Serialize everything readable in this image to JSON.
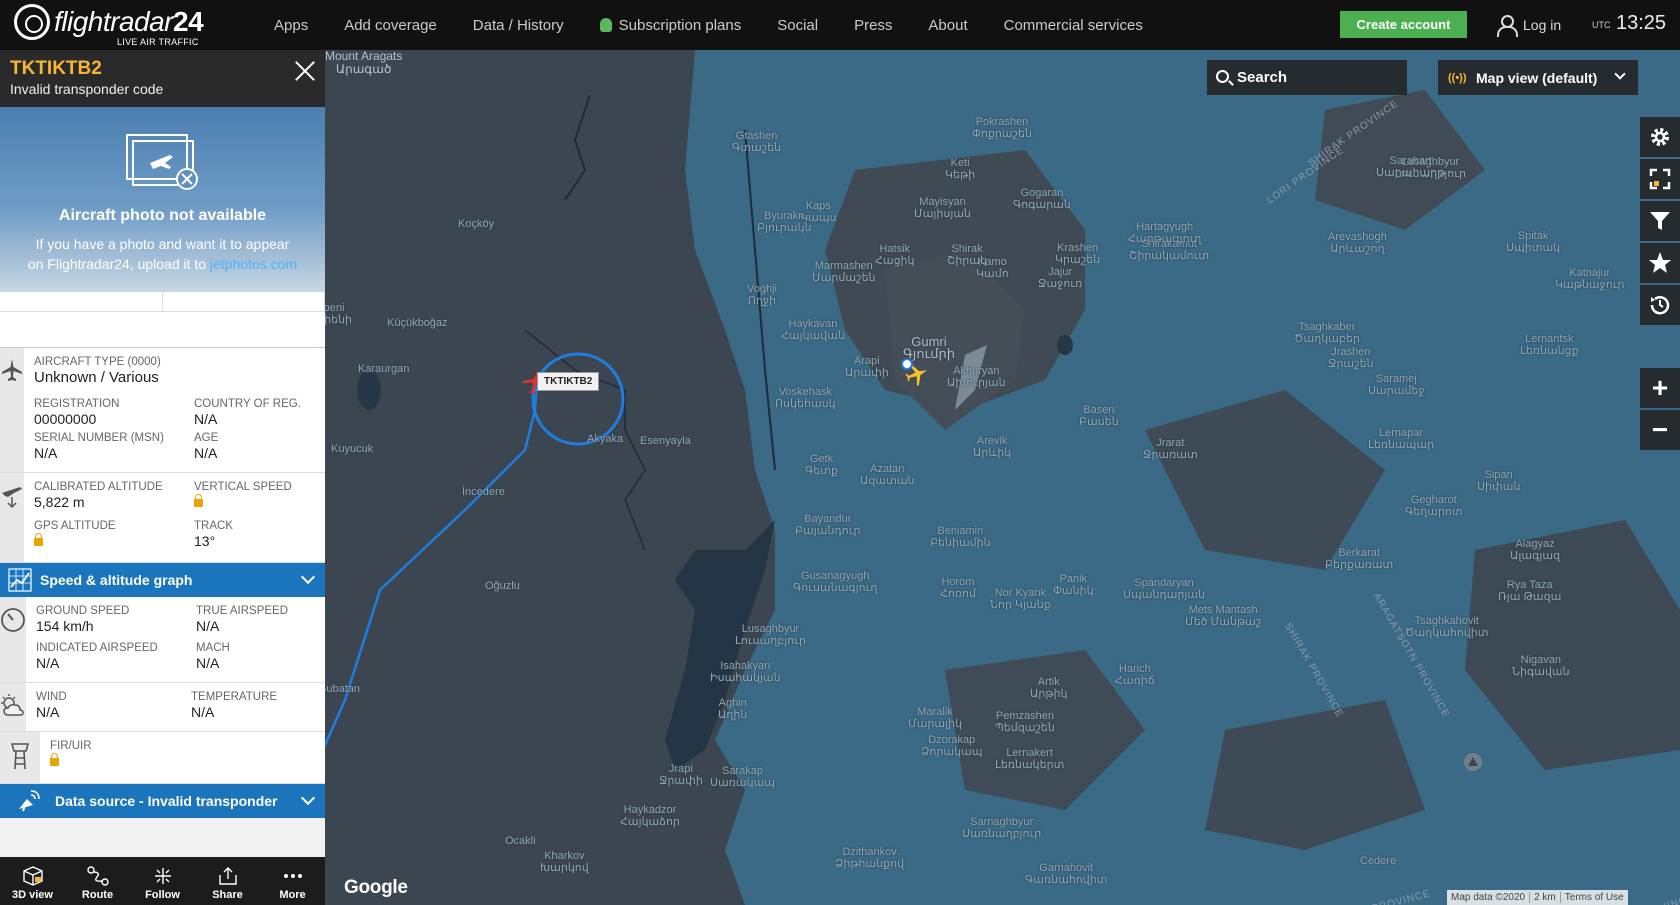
{
  "header": {
    "logo_text": "flightradar",
    "logo_num": "24",
    "logo_sub": "LIVE AIR TRAFFIC",
    "nav": [
      "Apps",
      "Add coverage",
      "Data / History",
      "Subscription plans",
      "Social",
      "Press",
      "About",
      "Commercial services"
    ],
    "create_account": "Create account",
    "login": "Log in",
    "utc_label": "UTC",
    "time": "13:25"
  },
  "panel": {
    "callsign": "TKTIKTB2",
    "subtitle": "Invalid transponder code",
    "photo_title": "Aircraft photo not available",
    "photo_text_1": "If you have a photo and want it to appear",
    "photo_text_2": "on Flightradar24, upload it to",
    "photo_link": "jetphotos.com",
    "aircraft_type_label": "AIRCRAFT TYPE",
    "aircraft_type_code": "(0000)",
    "aircraft_type_value": "Unknown / Various",
    "registration_label": "REGISTRATION",
    "registration_value": "00000000",
    "country_label": "COUNTRY OF REG.",
    "country_value": "N/A",
    "msn_label": "SERIAL NUMBER (MSN)",
    "msn_value": "N/A",
    "age_label": "AGE",
    "age_value": "N/A",
    "cal_alt_label": "CALIBRATED ALTITUDE",
    "cal_alt_value": "5,822 m",
    "vspeed_label": "VERTICAL SPEED",
    "gps_alt_label": "GPS ALTITUDE",
    "track_label": "TRACK",
    "track_value": "13°",
    "speed_graph": "Speed & altitude graph",
    "ground_speed_label": "GROUND SPEED",
    "ground_speed_value": "154 km/h",
    "tas_label": "TRUE AIRSPEED",
    "tas_value": "N/A",
    "ias_label": "INDICATED AIRSPEED",
    "ias_value": "N/A",
    "mach_label": "MACH",
    "mach_value": "N/A",
    "wind_label": "WIND",
    "wind_value": "N/A",
    "temp_label": "TEMPERATURE",
    "temp_value": "N/A",
    "fir_label": "FIR/UIR",
    "data_source": "Data source - Invalid transponder",
    "tools": [
      "3D view",
      "Route",
      "Follow",
      "Share",
      "More"
    ]
  },
  "map": {
    "search": "Search",
    "view": "Map view (default)",
    "flight_tag": "TKTIKTB2",
    "google": "Google",
    "attribution": [
      "Map data ©2020",
      "2 km",
      "Terms of Use"
    ],
    "labels": [
      {
        "t": "Gtashen\nԳտաշեն"
      },
      {
        "t": "Kaps\nԿապս"
      },
      {
        "t": "Byurakn\nԲյուրակն"
      },
      {
        "t": "Koçköy"
      },
      {
        "t": "Marmashen\nՄարմաշեն"
      },
      {
        "t": "Voghji\nՈղջի"
      },
      {
        "t": "Küçükboğaz"
      },
      {
        "t": "Karaurgan"
      },
      {
        "t": "Kuyucuk"
      },
      {
        "t": "İncedere"
      },
      {
        "t": "Akyaka"
      },
      {
        "t": "Esenyayla"
      },
      {
        "t": "Haykavan\nՀայկավան"
      },
      {
        "t": "Voskehask\nՈսկեհասկ"
      },
      {
        "t": "Arapi\nԱրափի"
      },
      {
        "t": "Gumri\nԳյումրի"
      },
      {
        "t": "Akhuryan\nԱխուրյան"
      },
      {
        "t": "Getk\nԳետք"
      },
      {
        "t": "Azatan\nԱզատան"
      },
      {
        "t": "Arevik\nԱրևիկ"
      },
      {
        "t": "Bayandur\nԲայանդուր"
      },
      {
        "t": "Beniamin\nԲենիամին"
      },
      {
        "t": "Oğuzlu"
      },
      {
        "t": "Gusanagyugh\nԳուսանագյուղ"
      },
      {
        "t": "Horom\nՀոռոմ"
      },
      {
        "t": "Nor Kyank\nՆոր Կյանք"
      },
      {
        "t": "Lusaghbyur\nԼուսաղբյուր"
      },
      {
        "t": "Isahakyan\nԻսահակյան"
      },
      {
        "t": "Aghin\nԱղին"
      },
      {
        "t": "Subatan"
      },
      {
        "t": "Jrapi\nՋրափի"
      },
      {
        "t": "Sarakap\nՍառակապ"
      },
      {
        "t": "Haykadzor\nՀայկաձոր"
      },
      {
        "t": "Ocakli"
      },
      {
        "t": "Kharkov\nԽարկով"
      },
      {
        "t": "Maralik\nՄարալիկ"
      },
      {
        "t": "Dzorakap\nՁորակապ"
      },
      {
        "t": "Pemzashen\nՊեմզաշեն"
      },
      {
        "t": "Lernakert\nԼեռնակերտ"
      },
      {
        "t": "Artik\nԱրթիկ"
      },
      {
        "t": "Harich\nՀառիճ"
      },
      {
        "t": "Sarnaghbyur\nՍառնաղբյուր"
      },
      {
        "t": "Dzithankov\nՁիթհանքով"
      },
      {
        "t": "Garnahovit\nԳառնահովիտ"
      },
      {
        "t": "Basen\nԲասեն"
      },
      {
        "t": "Jrarat\nՋրառատ"
      },
      {
        "t": "Lernapar\nԼեռնապար"
      },
      {
        "t": "Gegharot\nԳեղարոտ"
      },
      {
        "t": "Berkarat\nԲերքառատ"
      },
      {
        "t": "Spandaryan\nՍպանդարյան"
      },
      {
        "t": "Mets Mantash\nՄեծ Մանթաշ"
      },
      {
        "t": "Panik\nՓանիկ"
      },
      {
        "t": "Alagyaz\nԱլագյազ"
      },
      {
        "t": "Rya Taza\nՌյա Թազա"
      },
      {
        "t": "Tsaghkahovit\nԾաղկահովիտ"
      },
      {
        "t": "Nigavan\nՆիգավան"
      },
      {
        "t": "Sipan\nՍիփան"
      },
      {
        "t": "Saramej\nՍարամեջ"
      },
      {
        "t": "Jrashen\nՋրաշեն"
      },
      {
        "t": "Lernantsk\nԼեռնանցք"
      },
      {
        "t": "Tsaghkaber\nԾաղկաբեր"
      },
      {
        "t": "Katnajur\nԿաթնաջուր"
      },
      {
        "t": "Spitak\nՍպիտակ"
      },
      {
        "t": "Arevashogh\nԱրևաշող"
      },
      {
        "t": "Shirakamut\nՇիրակամուտ"
      },
      {
        "t": "Hartagyugh\nՀարթագյուղ"
      },
      {
        "t": "Lusaghbyur\nԼուսաղբյուր"
      },
      {
        "t": "Sarahart\nՍարահարթ"
      },
      {
        "t": "Gogaran\nԳոգարան"
      },
      {
        "t": "Krashen\nԿրաշեն"
      },
      {
        "t": "Jajur\nՋաջուռ"
      },
      {
        "t": "Kamo\nԿամո"
      },
      {
        "t": "Shirak\nՇիրակ"
      },
      {
        "t": "Hatsik\nՀացիկ"
      },
      {
        "t": "Mayisyan\nՄայիսյան"
      },
      {
        "t": "Keti\nԿեթի"
      },
      {
        "t": "Pokrashen\nՓոքրաշեն"
      },
      {
        "t": "Arpeni\nԱրփենի"
      },
      {
        "t": "Cedere"
      },
      {
        "t": "Mount Aragats\nԱրագած"
      }
    ],
    "provinces": [
      "SHIRAK PROVINCE",
      "LORI PROVINCE",
      "ARAGATSOTN PROVINCE",
      "SHIRAK PROVINCE",
      "SHIRAK PROVINCE",
      "SHIRAK PROVINCE"
    ]
  }
}
